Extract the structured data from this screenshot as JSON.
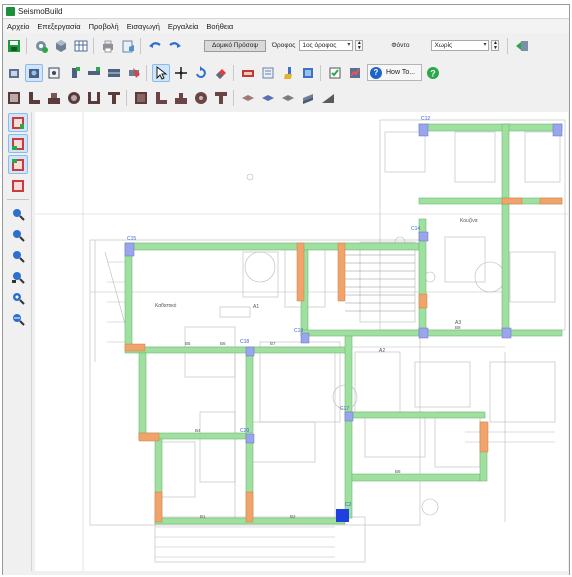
{
  "window": {
    "title": "SeismoBuild"
  },
  "menu": {
    "items": [
      "Αρχείο",
      "Επεξεργασία",
      "Προβολή",
      "Εισαγωγή",
      "Εργαλεία",
      "Βοήθεια"
    ]
  },
  "toolbar": {
    "structure_button_label": "Δομικό Πρόσοψ",
    "floor_label": "Όροφος",
    "floor_value": "1ος όροφος",
    "background_label": "Φόντο",
    "background_value": "Χωρίς",
    "howto_label": "How To..."
  },
  "plan": {
    "column_labels": [
      "C15",
      "C12",
      "C14",
      "C19",
      "C18",
      "C17",
      "C20",
      "C2"
    ],
    "beam_labels": [
      "B1",
      "B2",
      "B4",
      "B5",
      "B6",
      "B7",
      "B8",
      "B9"
    ],
    "room_labels": [
      "Καθιστικό",
      "Κουζίνα",
      "A1",
      "A2",
      "A3"
    ],
    "accent_colors": {
      "beam": "#9fe0a0",
      "column_orange": "#f0a36a",
      "column_blue": "#9aa5ec",
      "selected": "#1f3fe0"
    }
  }
}
